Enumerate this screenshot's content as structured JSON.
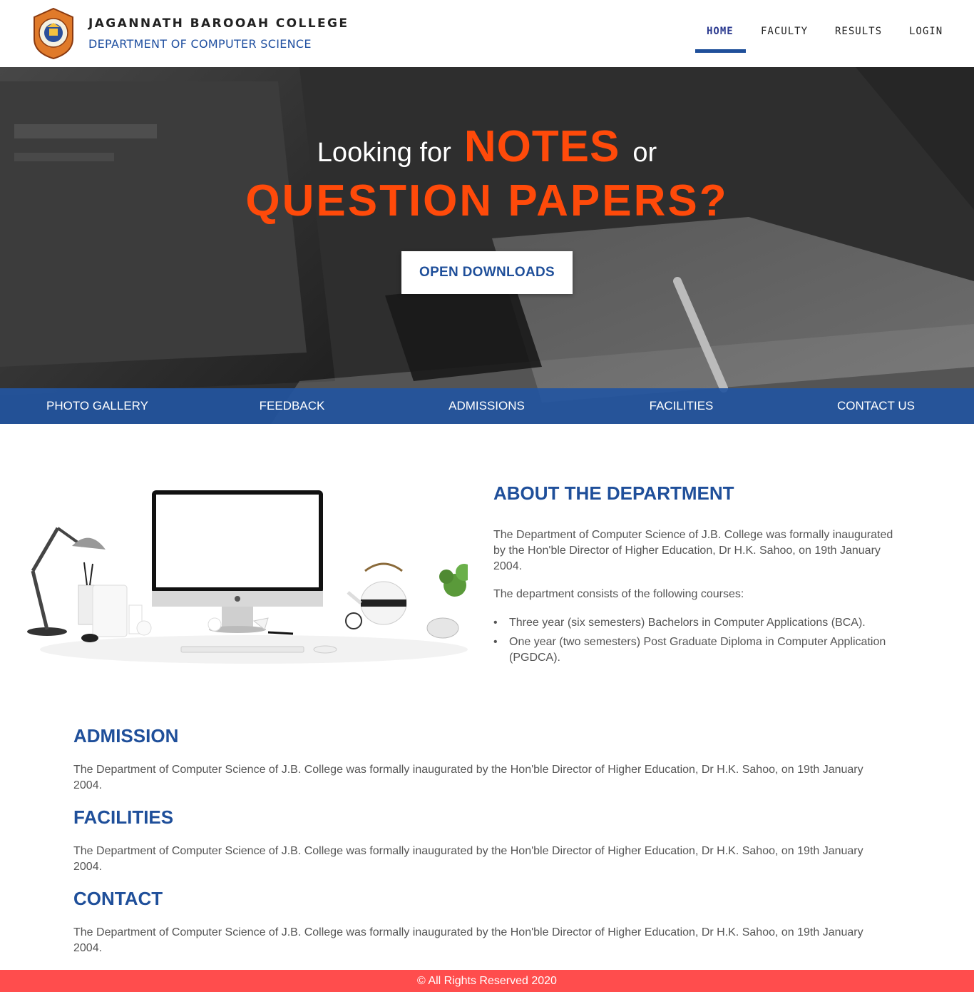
{
  "header": {
    "college_name": "JAGANNATH BAROOAH COLLEGE",
    "department_name": "DEPARTMENT OF COMPUTER SCIENCE",
    "nav": [
      {
        "label": "HOME",
        "active": true
      },
      {
        "label": "FACULTY",
        "active": false
      },
      {
        "label": "RESULTS",
        "active": false
      },
      {
        "label": "LOGIN",
        "active": false
      }
    ]
  },
  "hero": {
    "line1_prefix": "Looking for",
    "line1_highlight": "NOTES",
    "line1_suffix": "or",
    "line2": "QUESTION PAPERS?",
    "cta_label": "OPEN DOWNLOADS"
  },
  "subnav": [
    {
      "label": "PHOTO GALLERY"
    },
    {
      "label": "FEEDBACK"
    },
    {
      "label": "ADMISSIONS"
    },
    {
      "label": "FACILITIES"
    },
    {
      "label": "CONTACT US"
    }
  ],
  "about": {
    "title": "ABOUT THE DEPARTMENT",
    "paragraph1": "The Department of Computer Science of J.B. College was formally inaugurated by the Hon'ble Director of Higher Education, Dr H.K. Sahoo, on 19th January 2004.",
    "paragraph2": "The department consists of the following courses:",
    "courses": [
      "Three year (six semesters) Bachelors in Computer Applications (BCA).",
      "One year (two semesters) Post Graduate Diploma in Computer Application (PGDCA)."
    ]
  },
  "sections": [
    {
      "title": "ADMISSION",
      "text": "The Department of Computer Science of J.B. College was formally inaugurated by the Hon'ble Director of Higher Education, Dr H.K. Sahoo, on 19th January 2004."
    },
    {
      "title": "FACILITIES",
      "text": "The Department of Computer Science of J.B. College was formally inaugurated by the Hon'ble Director of Higher Education, Dr H.K. Sahoo, on 19th January 2004."
    },
    {
      "title": "CONTACT",
      "text": "The Department of Computer Science of J.B. College was formally inaugurated by the Hon'ble Director of Higher Education, Dr H.K. Sahoo, on 19th January 2004."
    }
  ],
  "footer": {
    "text": "© All Rights Reserved 2020"
  },
  "colors": {
    "brand_blue": "#1f4f9a",
    "accent_orange": "#ff4a0a",
    "footer_red": "#ff4d4d"
  }
}
